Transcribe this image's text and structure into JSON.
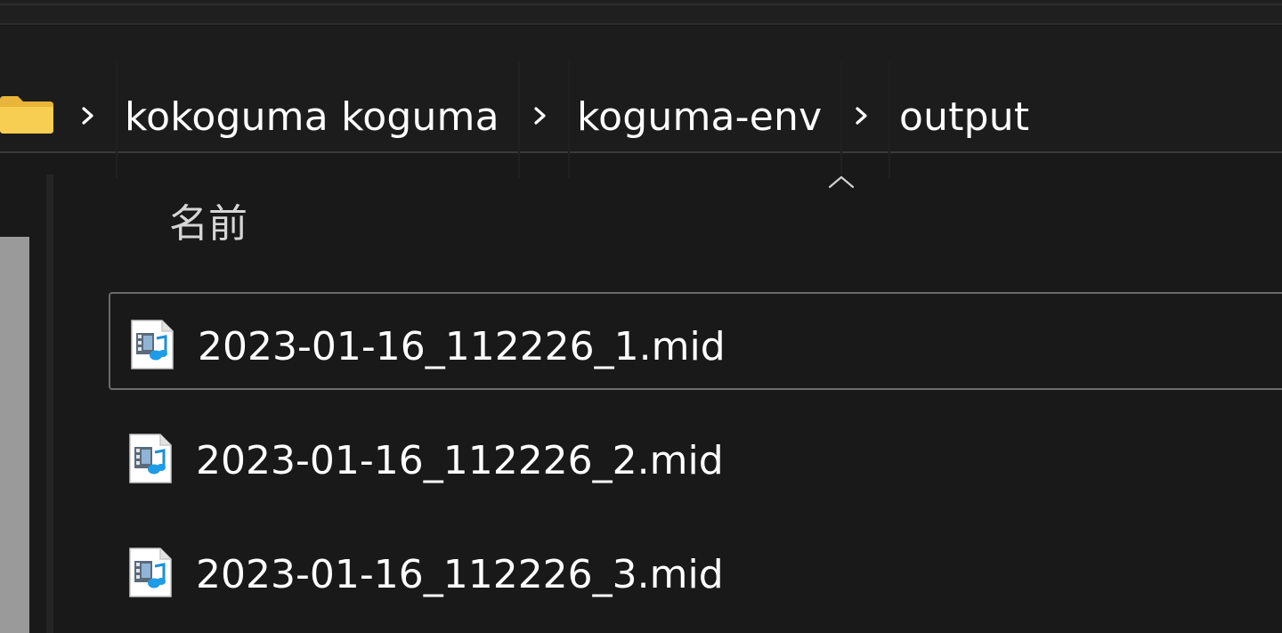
{
  "breadcrumb": {
    "items": [
      {
        "label": "kokoguma koguma"
      },
      {
        "label": "koguma-env"
      },
      {
        "label": "output"
      }
    ]
  },
  "file_list": {
    "column_header": "名前",
    "sort": "ascending",
    "files": [
      {
        "name": "2023-01-16_112226_1.mid",
        "selected": true
      },
      {
        "name": "2023-01-16_112226_2.mid",
        "selected": false
      },
      {
        "name": "2023-01-16_112226_3.mid",
        "selected": false
      }
    ]
  },
  "colors": {
    "background": "#191919",
    "folder": "#f5c84c",
    "selection_border": "#6b6b6b"
  },
  "icons": {
    "folder": "folder-icon",
    "separator": "chevron-right-icon",
    "sort": "sort-ascending-icon",
    "file": "midi-file-icon"
  }
}
